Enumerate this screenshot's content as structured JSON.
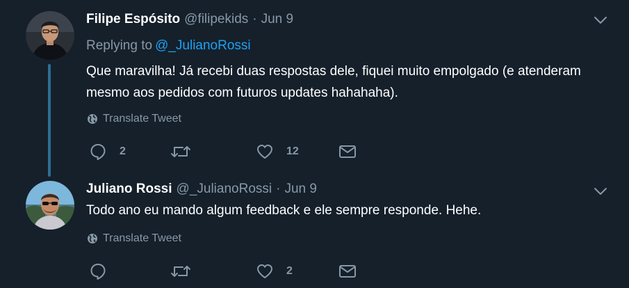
{
  "tweets": [
    {
      "name": "Filipe Espósito",
      "handle": "@filipekids",
      "separator": "·",
      "date": "Jun 9",
      "replying_label": "Replying to",
      "replying_to": "@_JulianoRossi",
      "text": "Que maravilha! Já recebi duas respostas dele, fiquei muito empolgado (e atenderam mesmo aos pedidos com futuros updates hahahaha).",
      "translate": "Translate Tweet",
      "reply_count": "2",
      "retweet_count": "",
      "like_count": "12"
    },
    {
      "name": "Juliano Rossi",
      "handle": "@_JulianoRossi",
      "separator": "·",
      "date": "Jun 9",
      "text": "Todo ano eu mando algum feedback e ele sempre responde. Hehe.",
      "translate": "Translate Tweet",
      "reply_count": "",
      "retweet_count": "",
      "like_count": "2"
    }
  ],
  "colors": {
    "background": "#15202b",
    "secondary_text": "#8899a6",
    "link": "#1da1f2",
    "thread_line": "#2f6f93"
  },
  "icons": [
    "chevron-down-icon",
    "globe-icon",
    "reply-icon",
    "retweet-icon",
    "like-icon",
    "message-icon"
  ]
}
